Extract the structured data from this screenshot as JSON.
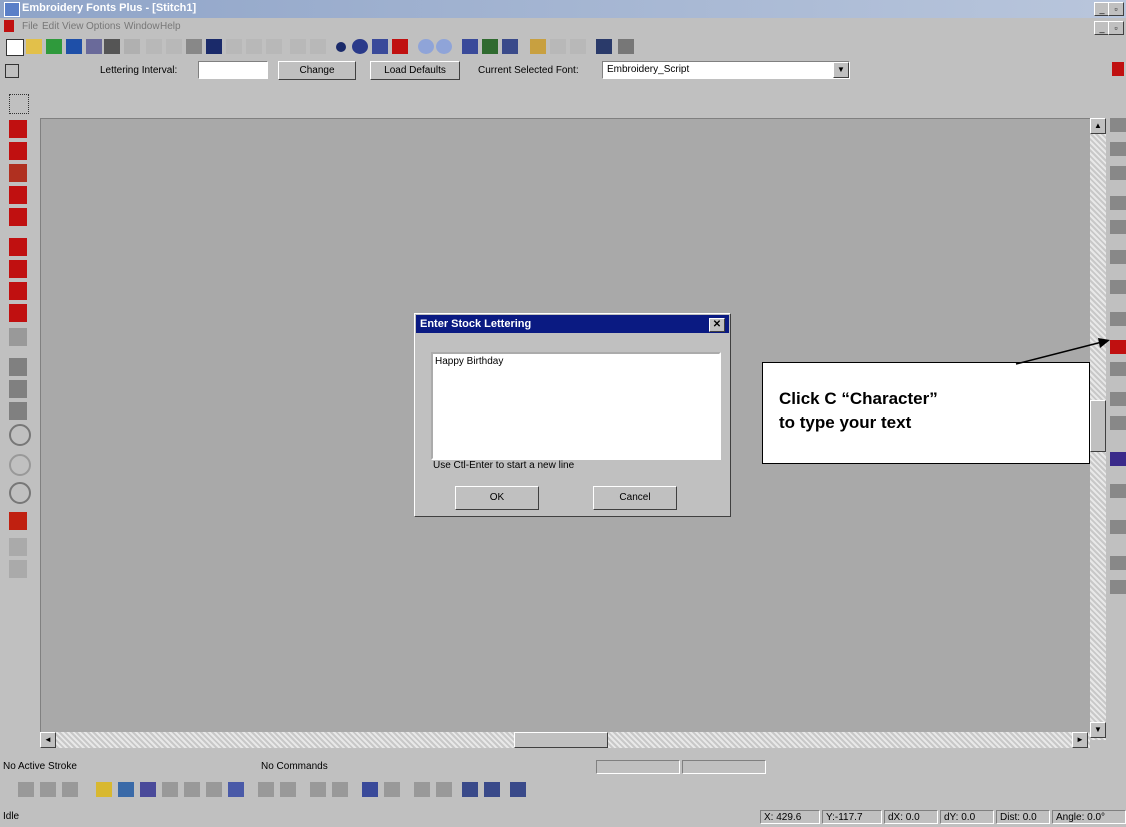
{
  "window": {
    "title": "Embroidery Fonts Plus - [Stitch1]"
  },
  "menu": {
    "items": [
      "File",
      "Edit",
      "View",
      "Options",
      "Window",
      "Help"
    ]
  },
  "toolbar2": {
    "lettering_interval_label": "Lettering Interval:",
    "lettering_interval_value": "",
    "change_label": "Change",
    "load_defaults_label": "Load Defaults",
    "current_font_label": "Current Selected Font:",
    "current_font_value": "Embroidery_Script"
  },
  "dialog": {
    "title": "Enter Stock Lettering",
    "text_value": "Happy Birthday",
    "hint": "Use Ctl-Enter to start a new line",
    "ok_label": "OK",
    "cancel_label": "Cancel"
  },
  "callout": {
    "line1": "Click C “Character”",
    "line2": "to type your text"
  },
  "status_top": {
    "stroke": "No Active Stroke",
    "commands": "No Commands"
  },
  "status_bottom": {
    "state": "Idle",
    "x": "X: 429.6",
    "y": "Y:-117.7",
    "dx": "dX:  0.0",
    "dy": "dY:  0.0",
    "dist": "Dist:  0.0",
    "angle": "Angle:  0.0°"
  },
  "colors": {
    "title_bar": "#8fa4c8",
    "dialog_title": "#0a1a82",
    "canvas": "#a9a9a9",
    "tool_red": "#c01010"
  }
}
